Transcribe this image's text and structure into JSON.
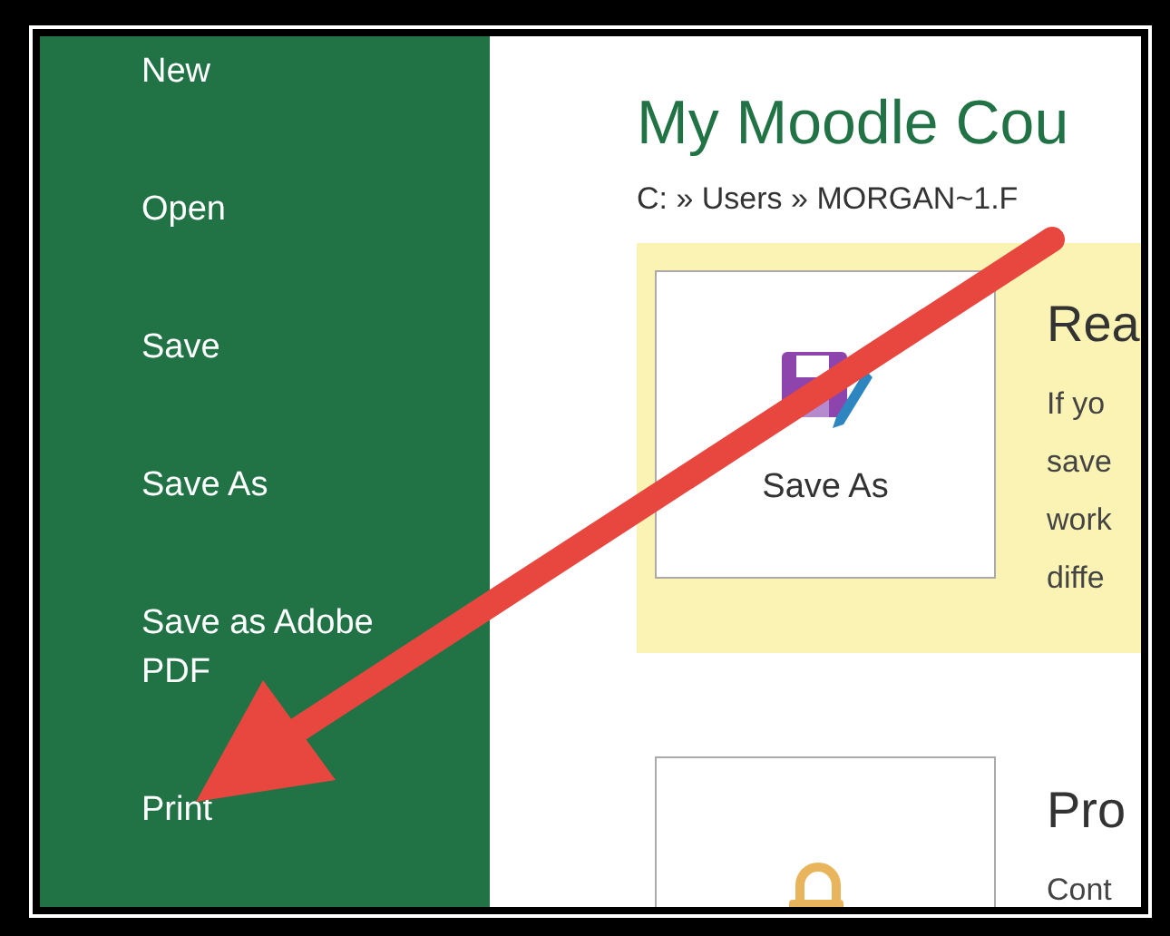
{
  "sidebar": {
    "items": [
      {
        "label": "New"
      },
      {
        "label": "Open"
      },
      {
        "label": "Save"
      },
      {
        "label": "Save As"
      },
      {
        "label": "Save as Adobe PDF"
      },
      {
        "label": "Print"
      }
    ]
  },
  "main": {
    "title": "My Moodle Cou",
    "path": "C: » Users » MORGAN~1.F",
    "sections": [
      {
        "kind": "highlight",
        "button": "Save As",
        "heading": "Rea",
        "lines": [
          "If yo",
          "save",
          "work",
          "diffe"
        ]
      },
      {
        "kind": "plain",
        "heading": "Pro",
        "lines": [
          "Cont"
        ]
      }
    ]
  }
}
